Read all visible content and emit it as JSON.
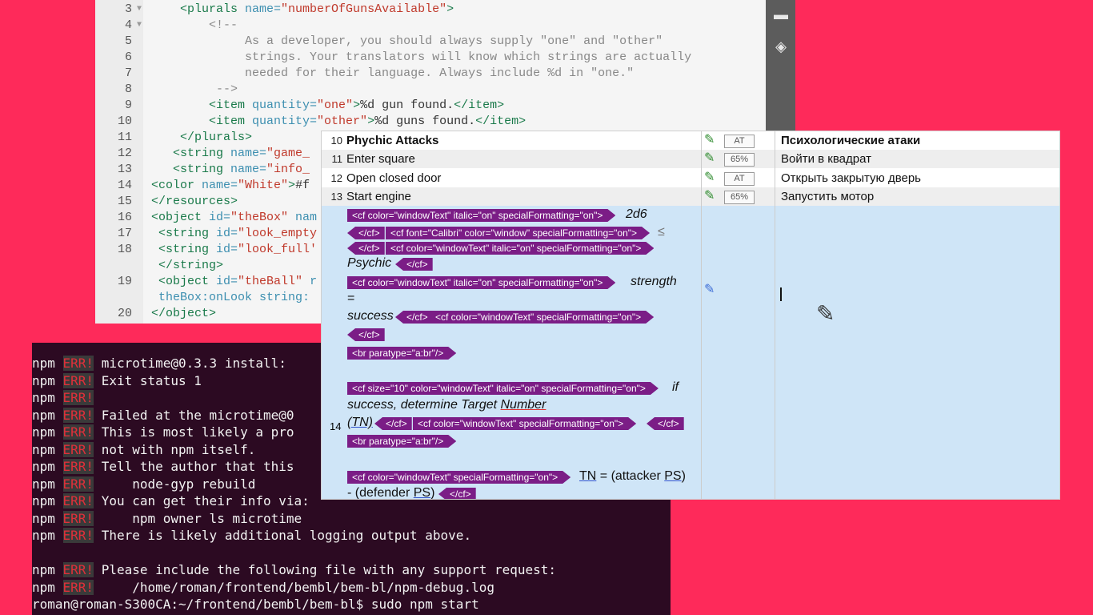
{
  "editor": {
    "lines": [
      {
        "n": "3",
        "fold": "▼",
        "indent": "    ",
        "parts": [
          [
            "tag",
            "<plurals "
          ],
          [
            "attr",
            "name="
          ],
          [
            "val",
            "\"numberOfGunsAvailable\""
          ],
          [
            "tag",
            ">"
          ]
        ]
      },
      {
        "n": "4",
        "fold": "▼",
        "indent": "        ",
        "parts": [
          [
            "comment",
            "<!--"
          ]
        ]
      },
      {
        "n": "5",
        "fold": "",
        "indent": "             ",
        "parts": [
          [
            "comment",
            "As a developer, you should always supply \"one\" and \"other\""
          ]
        ]
      },
      {
        "n": "6",
        "fold": "",
        "indent": "             ",
        "parts": [
          [
            "comment",
            "strings. Your translators will know which strings are actually"
          ]
        ]
      },
      {
        "n": "7",
        "fold": "",
        "indent": "             ",
        "parts": [
          [
            "comment",
            "needed for their language. Always include %d in \"one.\""
          ]
        ]
      },
      {
        "n": "8",
        "fold": "",
        "indent": "         ",
        "parts": [
          [
            "comment",
            "-->"
          ]
        ]
      },
      {
        "n": "9",
        "fold": "",
        "indent": "        ",
        "parts": [
          [
            "tag",
            "<item "
          ],
          [
            "attr",
            "quantity="
          ],
          [
            "val",
            "\"one\""
          ],
          [
            "tag",
            ">"
          ],
          [
            "txt",
            "%d gun found."
          ],
          [
            "tag",
            "</item>"
          ]
        ]
      },
      {
        "n": "10",
        "fold": "",
        "indent": "        ",
        "parts": [
          [
            "tag",
            "<item "
          ],
          [
            "attr",
            "quantity="
          ],
          [
            "val",
            "\"other\""
          ],
          [
            "tag",
            ">"
          ],
          [
            "txt",
            "%d guns found."
          ],
          [
            "tag",
            "</item>"
          ]
        ]
      },
      {
        "n": "11",
        "fold": "",
        "indent": "    ",
        "parts": [
          [
            "tag",
            "</plurals>"
          ]
        ]
      },
      {
        "n": "12",
        "fold": "",
        "indent": "   ",
        "parts": [
          [
            "tag",
            "<string "
          ],
          [
            "attr",
            "name="
          ],
          [
            "val",
            "\"game_"
          ]
        ]
      },
      {
        "n": "13",
        "fold": "",
        "indent": "   ",
        "parts": [
          [
            "tag",
            "<string "
          ],
          [
            "attr",
            "name="
          ],
          [
            "val",
            "\"info_"
          ]
        ]
      },
      {
        "n": "14",
        "fold": "",
        "indent": "",
        "parts": [
          [
            "tag",
            "<color "
          ],
          [
            "attr",
            "name="
          ],
          [
            "val",
            "\"White\""
          ],
          [
            "tag",
            ">"
          ],
          [
            "txt",
            "#f"
          ]
        ]
      },
      {
        "n": "15",
        "fold": "",
        "indent": "",
        "parts": [
          [
            "tag",
            "</resources>"
          ]
        ]
      },
      {
        "n": "16",
        "fold": "",
        "indent": "",
        "parts": [
          [
            "tag",
            "<object "
          ],
          [
            "attr",
            "id="
          ],
          [
            "val",
            "\"theBox\""
          ],
          [
            "attr",
            " nam"
          ]
        ]
      },
      {
        "n": "17",
        "fold": "",
        "indent": " ",
        "parts": [
          [
            "tag",
            "<string "
          ],
          [
            "attr",
            "id="
          ],
          [
            "val",
            "\"look_empty"
          ]
        ]
      },
      {
        "n": "18",
        "fold": "",
        "indent": " ",
        "parts": [
          [
            "tag",
            "<string "
          ],
          [
            "attr",
            "id="
          ],
          [
            "val",
            "\"look_full'"
          ]
        ]
      },
      {
        "n": "",
        "fold": "",
        "indent": " ",
        "parts": [
          [
            "tag",
            "</string>"
          ]
        ]
      },
      {
        "n": "19",
        "fold": "",
        "indent": " ",
        "parts": [
          [
            "tag",
            "<object "
          ],
          [
            "attr",
            "id="
          ],
          [
            "val",
            "\"theBall\""
          ],
          [
            "attr",
            " r"
          ]
        ]
      },
      {
        "n": "",
        "fold": "",
        "indent": " ",
        "parts": [
          [
            "attr",
            "theBox:onLook string:"
          ]
        ]
      },
      {
        "n": "20",
        "fold": "",
        "indent": "",
        "parts": [
          [
            "tag",
            "</object>"
          ]
        ]
      }
    ]
  },
  "terminal": {
    "lines": [
      {
        "prefix": "npm",
        "err": "ERR!",
        "text": " microtime@0.3.3 install: "
      },
      {
        "prefix": "npm",
        "err": "ERR!",
        "text": " Exit status 1"
      },
      {
        "prefix": "npm",
        "err": "ERR!",
        "text": ""
      },
      {
        "prefix": "npm",
        "err": "ERR!",
        "text": " Failed at the microtime@0"
      },
      {
        "prefix": "npm",
        "err": "ERR!",
        "text": " This is most likely a pro"
      },
      {
        "prefix": "npm",
        "err": "ERR!",
        "text": " not with npm itself."
      },
      {
        "prefix": "npm",
        "err": "ERR!",
        "text": " Tell the author that this"
      },
      {
        "prefix": "npm",
        "err": "ERR!",
        "text": "     node-gyp rebuild"
      },
      {
        "prefix": "npm",
        "err": "ERR!",
        "text": " You can get their info via:"
      },
      {
        "prefix": "npm",
        "err": "ERR!",
        "text": "     npm owner ls microtime"
      },
      {
        "prefix": "npm",
        "err": "ERR!",
        "text": " There is likely additional logging output above."
      },
      {
        "prefix": "",
        "err": "",
        "text": ""
      },
      {
        "prefix": "npm",
        "err": "ERR!",
        "text": " Please include the following file with any support request:"
      },
      {
        "prefix": "npm",
        "err": "ERR!",
        "text": "     /home/roman/frontend/bembl/bem-bl/npm-debug.log"
      },
      {
        "prefix": "",
        "err": "",
        "text": "roman@roman-S300CA:~/frontend/bembl/bem-bl$ sudo npm start"
      }
    ]
  },
  "grid": {
    "rows": [
      {
        "num": "10",
        "source": "Phychic Attacks",
        "status": "AT",
        "target": "Психологические атаки",
        "bold": true
      },
      {
        "num": "11",
        "source": "Enter square",
        "status": "65%",
        "target": "Войти в квадрат",
        "bold": false
      },
      {
        "num": "12",
        "source": "Open closed door",
        "status": "AT",
        "target": "Открыть закрытую дверь",
        "bold": false
      },
      {
        "num": "13",
        "source": "Start engine",
        "status": "65%",
        "target": "Запустить мотор",
        "bold": false
      }
    ],
    "active_num": "14",
    "chips": {
      "c1": "<cf color=\"windowText\" italic=\"on\" specialFormatting=\"on\">",
      "c2": "</cf>",
      "c3": "<cf font=\"Calibri\" color=\"window\" specialFormatting=\"on\">",
      "c4": "</cf>",
      "c5": "<cf color=\"windowText\" italic=\"on\" specialFormatting=\"on\">",
      "c6": "</cf>",
      "c7": "<cf color=\"windowText\" italic=\"on\" specialFormatting=\"on\">",
      "c8": "</cf>",
      "c9": "<cf color=\"windowText\" specialFormatting=\"on\">",
      "c10": "</cf>",
      "c11": "<br paratype=\"a:br\"/>",
      "c12": "<cf size=\"10\" color=\"windowText\" italic=\"on\" specialFormatting=\"on\">",
      "c13": "</cf>",
      "c14": "<cf color=\"windowText\" specialFormatting=\"on\">",
      "c15": "</cf>",
      "c16": "<br paratype=\"a:br\"/>",
      "c17": "<cf color=\"windowText\" specialFormatting=\"on\">",
      "c18": "</cf>"
    },
    "texts": {
      "t1": "2d6",
      "t2": "≤",
      "t3": "Psychic",
      "t4": "strength",
      "t5": "=",
      "t6": "success",
      "t7": "if",
      "t8": "success, determine Target ",
      "t8b": "Number",
      "t9": "(TN)",
      "t10a": "TN",
      "t10b": " = (attacker ",
      "t10c": "PS",
      "t10d": ")",
      "t11a": "- (defender ",
      "t11b": "PS",
      "t11c": ")"
    }
  }
}
